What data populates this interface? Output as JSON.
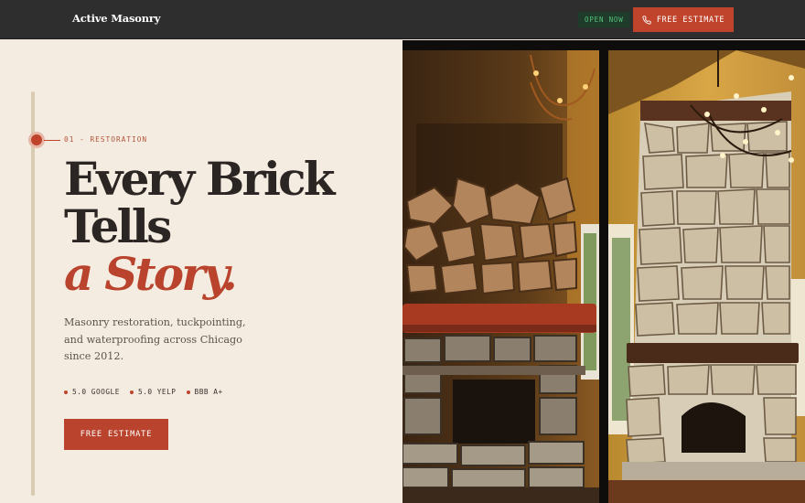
{
  "header": {
    "brand": "Active Masonry",
    "status": "OPEN NOW",
    "cta_label": "FREE ESTIMATE",
    "cta_icon": "phone-icon"
  },
  "hero": {
    "eyebrow": "01 - RESTORATION",
    "headline_line1": "Every Brick",
    "headline_line2": "Tells",
    "headline_line3": "a Story.",
    "lead": "Masonry restoration, tuckpointing, and waterproofing across Chicago since 2012.",
    "ratings": [
      "5.0 GOOGLE",
      "5.0 YELP",
      "BBB A+"
    ],
    "cta_label": "FREE ESTIMATE"
  },
  "colors": {
    "accent": "#c0432c",
    "page_bg": "#f4ece0",
    "topbar_bg": "#2e2e2e",
    "status_green": "#55c27c"
  }
}
